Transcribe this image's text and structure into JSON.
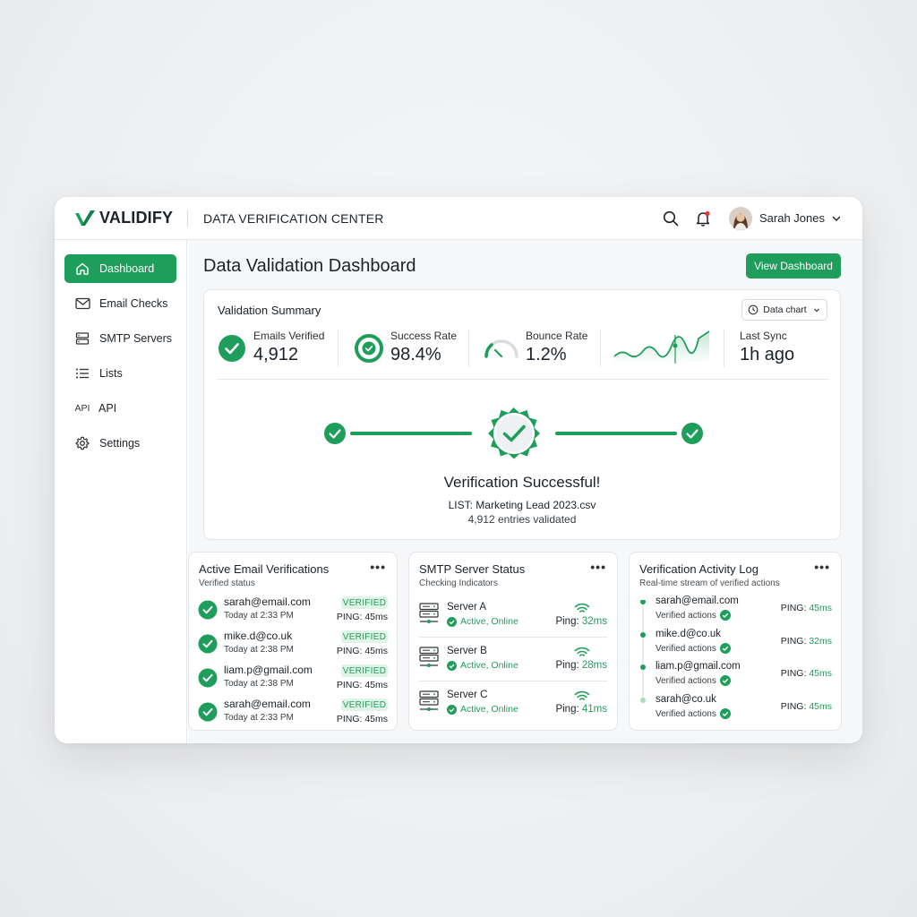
{
  "app": {
    "logo": "VALIDIFY",
    "section_title": "DATA VERIFICATION CENTER",
    "user_name": "Sarah Jones"
  },
  "sidebar": {
    "items": [
      {
        "label": "Dashboard",
        "icon": "home-icon",
        "active": true
      },
      {
        "label": "Email Checks",
        "icon": "mail-icon"
      },
      {
        "label": "SMTP Servers",
        "icon": "server-icon"
      },
      {
        "label": "Lists",
        "icon": "list-icon"
      },
      {
        "label": "API",
        "icon": "API"
      },
      {
        "label": "Settings",
        "icon": "gear-icon"
      }
    ]
  },
  "main": {
    "title": "Data Validation Dashboard",
    "view_button": "View Dashboard"
  },
  "summary": {
    "title": "Validation Summary",
    "chart_button": "Data chart",
    "stats": [
      {
        "label": "Emails Verified",
        "value": "4,912"
      },
      {
        "label": "Success Rate",
        "value": "98.4%"
      },
      {
        "label": "Bounce Rate",
        "value": "1.2%"
      },
      {
        "label": "Last Sync",
        "value": "1h ago"
      }
    ],
    "success_title": "Verification Successful!",
    "list_name": "LIST: Marketing Lead 2023.csv",
    "entries": "4,912 entries validated"
  },
  "active_verifications": {
    "title": "Active Email Verifications",
    "subtitle": "Verified status",
    "more": "•••",
    "rows": [
      {
        "email": "sarah@email.com",
        "time": "Today at 2:33 PM",
        "badge": "VERIFIED",
        "ping": "PING: 45ms"
      },
      {
        "email": "mike.d@co.uk",
        "time": "Today at 2:38 PM",
        "badge": "VERIFIED",
        "ping": "PING: 45ms"
      },
      {
        "email": "liam.p@gmail.com",
        "time": "Today at 2:38 PM",
        "badge": "VERIFIED",
        "ping": "PING: 45ms"
      },
      {
        "email": "sarah@email.com",
        "time": "Today at 2:33 PM",
        "badge": "VERIFIED",
        "ping": "PING: 45ms"
      }
    ]
  },
  "smtp_status": {
    "title": "SMTP Server Status",
    "subtitle": "Checking Indicators",
    "more": "•••",
    "servers": [
      {
        "name": "Server A",
        "status": "Active, Online",
        "ping_label": "Ping:",
        "ping_value": "32ms"
      },
      {
        "name": "Server B",
        "status": "Active, Online",
        "ping_label": "Ping:",
        "ping_value": "28ms"
      },
      {
        "name": "Server C",
        "status": "Active, Online",
        "ping_label": "Ping:",
        "ping_value": "41ms"
      }
    ]
  },
  "activity_log": {
    "title": "Verification Activity Log",
    "subtitle": "Real-time stream of verified actions",
    "more": "•••",
    "rows": [
      {
        "email": "sarah@email.com",
        "action": "Verified actions",
        "ping_label": "PING:",
        "ping_value": "45ms"
      },
      {
        "email": "mike.d@co.uk",
        "action": "Verified actions",
        "ping_label": "PING:",
        "ping_value": "32ms"
      },
      {
        "email": "liam.p@gmail.com",
        "action": "Verified actions",
        "ping_label": "PING:",
        "ping_value": "45ms"
      },
      {
        "email": "sarah@co.uk",
        "action": "Verified actions",
        "ping_label": "PING:",
        "ping_value": "45ms"
      }
    ]
  },
  "colors": {
    "accent": "#1e9e5a",
    "badge_bg": "#dff3e7",
    "notification": "#e53935"
  }
}
